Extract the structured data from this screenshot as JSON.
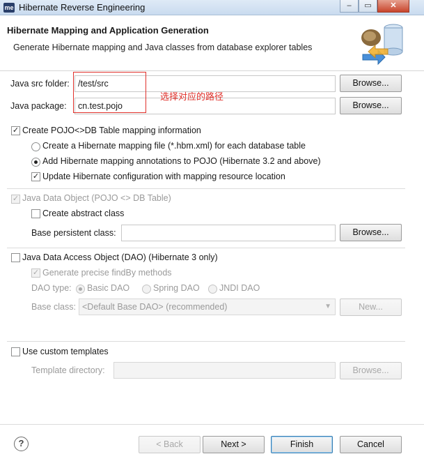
{
  "window": {
    "app_badge": "me",
    "title": "Hibernate Reverse Engineering",
    "controls": {
      "minimize": "–",
      "maximize": "▭",
      "close": "✕"
    }
  },
  "header": {
    "title": "Hibernate Mapping and Application Generation",
    "description": "Generate Hibernate mapping and Java classes from database explorer tables"
  },
  "form": {
    "src_folder": {
      "label": "Java src folder:",
      "value": "/test/src",
      "browse": "Browse..."
    },
    "package": {
      "label": "Java package:",
      "value": "cn.test.pojo",
      "browse": "Browse..."
    },
    "annotation_note": "选择对应的路径",
    "pojo_mapping": {
      "label": "Create POJO<>DB Table mapping information",
      "checked": true,
      "option_hbm": "Create a Hibernate mapping file (*.hbm.xml) for each database table",
      "option_annotations": "Add Hibernate mapping annotations to POJO (Hibernate 3.2 and above)",
      "update_config": "Update Hibernate configuration with mapping resource location"
    },
    "java_data_object": {
      "label": "Java Data Object (POJO <> DB Table)",
      "abstract_class": "Create abstract class",
      "base_class_label": "Base persistent class:",
      "base_class_value": "",
      "browse": "Browse..."
    },
    "dao": {
      "label": "Java Data Access Object (DAO) (Hibernate 3 only)",
      "precise_findby": "Generate precise findBy methods",
      "type_label": "DAO type:",
      "type_basic": "Basic DAO",
      "type_spring": "Spring DAO",
      "type_jndi": "JNDI DAO",
      "base_class_label": "Base class:",
      "base_class_value": "<Default Base DAO> (recommended)",
      "new_button": "New..."
    },
    "templates": {
      "label": "Use custom templates",
      "dir_label": "Template directory:",
      "dir_value": "",
      "browse": "Browse..."
    }
  },
  "footer": {
    "help": "?",
    "back": "< Back",
    "next": "Next >",
    "finish": "Finish",
    "cancel": "Cancel"
  },
  "colors": {
    "annotation": "#e0302a",
    "disabled_text": "#9a9a9a"
  }
}
